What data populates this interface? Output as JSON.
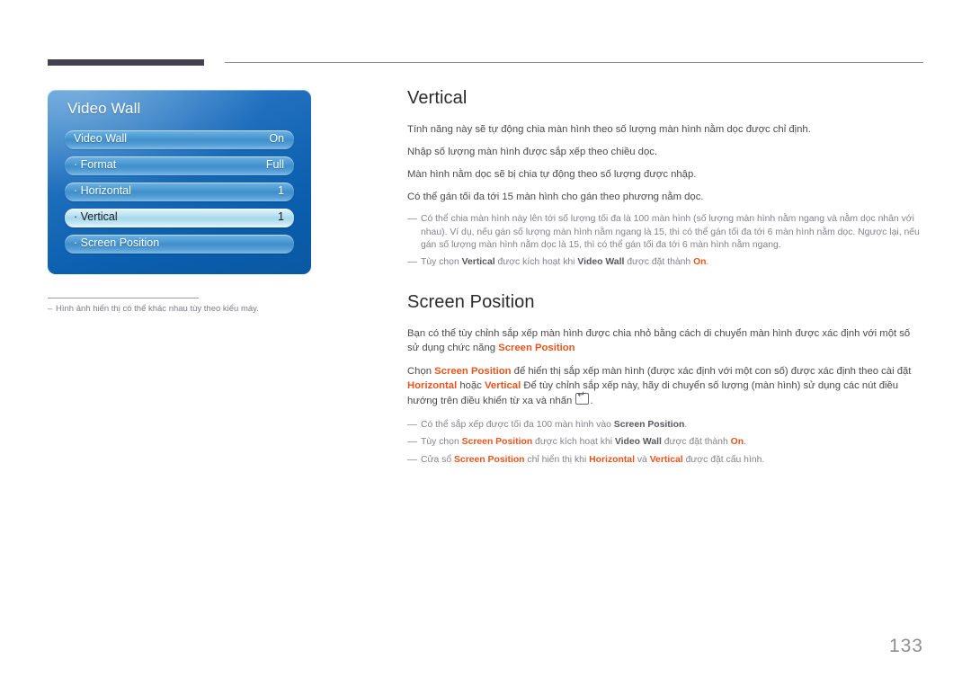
{
  "page": {
    "number": "133"
  },
  "osd": {
    "title": "Video Wall",
    "rows": [
      {
        "label": "Video Wall",
        "value": "On",
        "selected": false
      },
      {
        "label": "· Format",
        "value": "Full",
        "selected": false
      },
      {
        "label": "· Horizontal",
        "value": "1",
        "selected": false
      },
      {
        "label": "· Vertical",
        "value": "1",
        "selected": true
      },
      {
        "label": "· Screen Position",
        "value": "",
        "selected": false
      }
    ],
    "footnote": "Hình ảnh hiển thị có thể khác nhau tùy theo kiểu máy."
  },
  "sections": {
    "vertical": {
      "title": "Vertical",
      "lines": [
        "Tính năng này sẽ tự động chia màn hình theo số lượng màn hình nằm dọc được chỉ định.",
        "Nhập số lượng màn hình được sắp xếp theo chiều dọc.",
        "Màn hình nằm dọc sẽ bị chia tự động theo số lượng được nhập.",
        "Có thể gán tối đa tới 15 màn hình cho gán theo phương nằm dọc."
      ],
      "note_long": "Có thể chia màn hình này lên tới số lượng tối đa là 100 màn hình (số lượng màn hình nằm ngang và nằm dọc nhân với nhau). Ví dụ, nếu gán số lượng màn hình nằm ngang là 15, thì có thể gán tối đa tới 6 màn hình nằm dọc. Ngược lại, nếu gán số lượng màn hình nằm dọc là 15, thì có thể gán tối đa tới 6 màn hình nằm ngang.",
      "note_toggle": {
        "pre": "Tùy chọn ",
        "term1": "Vertical",
        "mid": " được kích hoạt khi ",
        "term2": "Video Wall",
        "mid2": " được đặt thành ",
        "term3": "On",
        "post": "."
      }
    },
    "screen_position": {
      "title": "Screen Position",
      "para1": {
        "pre": "Bạn có thể tùy chỉnh sắp xếp màn hình được chia nhỏ bằng cách di chuyển màn hình được xác định với một số sử dụng chức năng ",
        "term": "Screen Position"
      },
      "para2": {
        "pre": "Chọn ",
        "term1": "Screen Position",
        "mid1": " để hiển thị sắp xếp màn hình (được xác định với một con số) được xác định theo cài đặt ",
        "term2": "Horizontal",
        "mid2": " hoặc ",
        "term3": "Vertical",
        "mid3": " Để tùy chỉnh sắp xếp này, hãy di chuyển số lượng (màn hình) sử dụng các nút điều hướng trên điều khiển từ xa và nhấn ",
        "post": "."
      },
      "notes": [
        {
          "pre": "Có thể sắp xếp được tối đa 100 màn hình vào ",
          "term1": "Screen Position",
          "post": "."
        },
        {
          "pre": "Tùy chọn ",
          "term1": "Screen Position",
          "mid1": " được kích hoạt khi ",
          "term2": "Video Wall",
          "mid2": " được đặt thành ",
          "term3": "On",
          "post": "."
        },
        {
          "pre": "Cửa sổ ",
          "term1": "Screen Position",
          "mid1": " chỉ hiển thị khi ",
          "term2": "Horizontal",
          "mid2": " và ",
          "term3": "Vertical",
          "mid3": " được đặt cấu hình",
          "post": "."
        }
      ]
    }
  },
  "colors": {
    "highlight": "#e8551e",
    "osd_accent": "#0b5fae",
    "header_bar": "#44404d",
    "page_number": "#8e8e99"
  }
}
